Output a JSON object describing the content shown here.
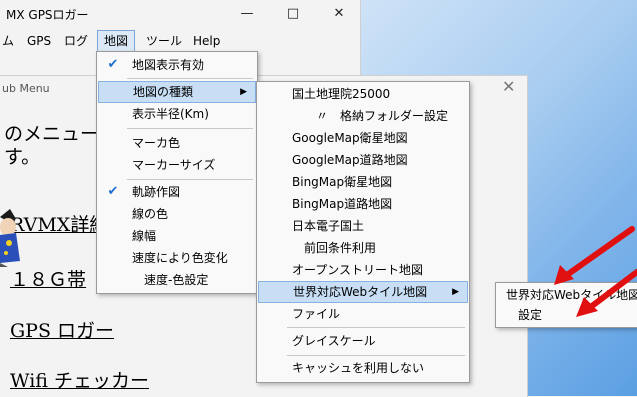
{
  "app": {
    "title": "MX GPSロガー",
    "minimize_icon": "minimize-icon",
    "maximize_icon": "maximize-icon",
    "close_icon": "close-icon"
  },
  "menubar": [
    "ム",
    "GPS",
    "ログ",
    "地図",
    "ツール",
    "Help"
  ],
  "subwindow": {
    "title": "ub Menu",
    "intro_line1": "のメニュー",
    "intro_line2": "す。",
    "links": [
      "RVMX詳細",
      "１８Ｇ帯",
      "GPS ロガー",
      "Wifi チェッカー"
    ]
  },
  "menu_map": {
    "items": [
      {
        "label": "地図表示有効",
        "checked": true
      },
      {
        "label": "地図の種類",
        "submenu": true,
        "selected": true
      },
      {
        "label": "表示半径(Km)"
      },
      {
        "label": "マーカ色"
      },
      {
        "label": "マーカーサイズ"
      },
      {
        "label": "軌跡作図",
        "checked": true
      },
      {
        "label": "線の色"
      },
      {
        "label": "線幅"
      },
      {
        "label": "速度により色変化"
      },
      {
        "label": "速度-色設定"
      }
    ]
  },
  "menu_map_types": {
    "items": [
      {
        "label": "国土地理院25000"
      },
      {
        "label": "〃　格納フォルダー設定"
      },
      {
        "label": "GoogleMap衛星地図"
      },
      {
        "label": "GoogleMap道路地図"
      },
      {
        "label": "BingMap衛星地図"
      },
      {
        "label": "BingMap道路地図"
      },
      {
        "label": "日本電子国土"
      },
      {
        "label": "前回条件利用"
      },
      {
        "label": "オープンストリート地図"
      },
      {
        "label": "世界対応Webタイル地図",
        "submenu": true,
        "selected": true
      },
      {
        "label": "ファイル"
      },
      {
        "label": "グレイスケール"
      },
      {
        "label": "キャッシュを利用しない"
      }
    ]
  },
  "menu_webtile": {
    "items": [
      {
        "label": "世界対応Webタイル地図"
      },
      {
        "label": "設定"
      }
    ]
  },
  "colors": {
    "accent": "#1e6fd0",
    "selection": "#c7def5",
    "annotation_arrow": "#e01010"
  }
}
